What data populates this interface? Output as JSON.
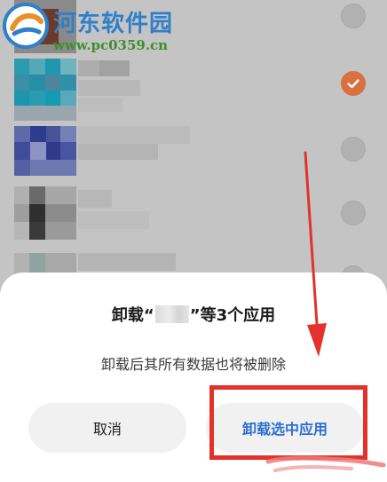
{
  "dialog": {
    "title_prefix": "卸载“",
    "title_suffix": "”等3个应用",
    "message": "卸载后其所有数据也将被删除",
    "cancel_label": "取消",
    "confirm_label": "卸载选中应用"
  },
  "watermark": {
    "title": "河东软件园",
    "url": "www.pc0359.cn"
  },
  "app_list": {
    "items": [
      {
        "checked": false
      },
      {
        "checked": true
      },
      {
        "checked": false
      },
      {
        "checked": false
      },
      {
        "checked": false
      }
    ]
  },
  "colors": {
    "accent": "#2c6fd0",
    "check": "#d9703f",
    "annotation": "#e2322b"
  },
  "icons": {
    "check": "checkmark-icon",
    "arrow": "red-arrow-annotation"
  }
}
